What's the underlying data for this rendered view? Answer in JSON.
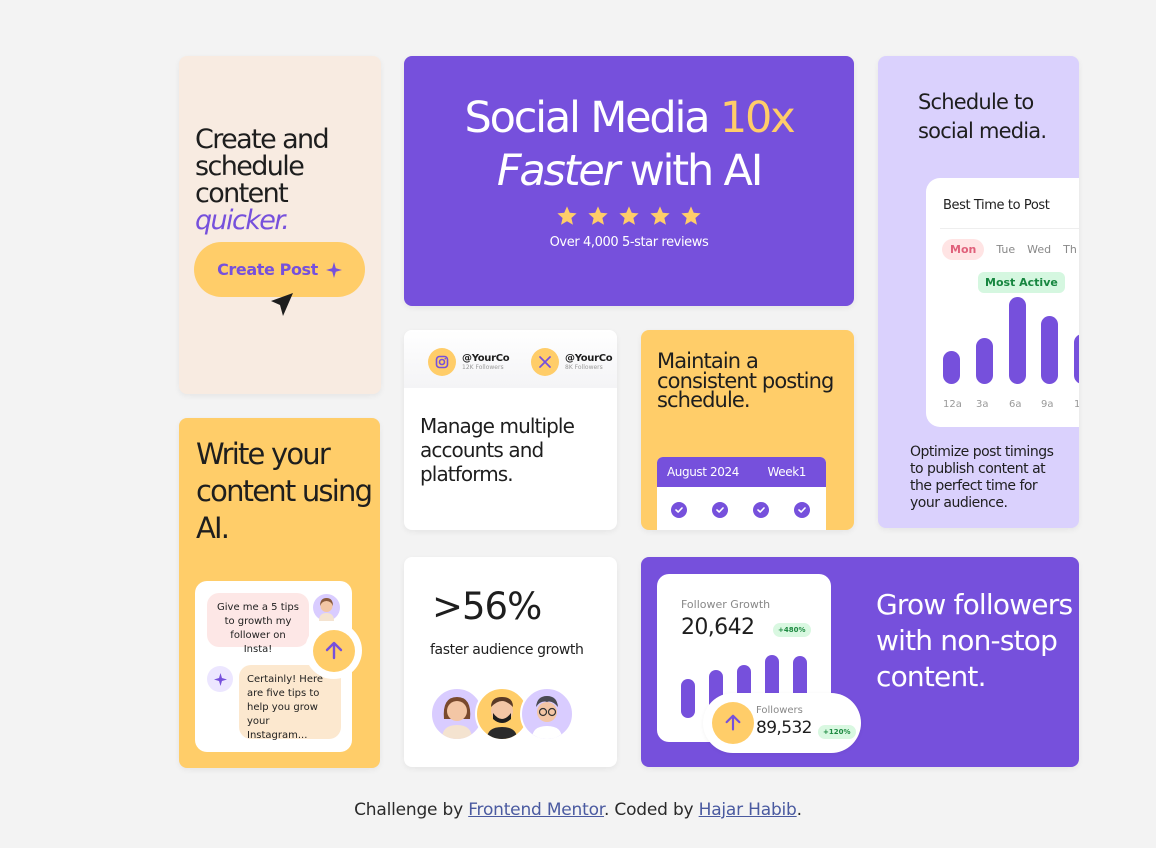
{
  "create": {
    "line1": "Create and",
    "line2": "schedule",
    "line3": "content",
    "accent": "quicker.",
    "button_label": "Create Post"
  },
  "hero": {
    "part1": "Social Media ",
    "accent": "10x",
    "italic": "Faster",
    "part2": " with AI",
    "rating": 5,
    "reviews": "Over 4,000 5-star reviews"
  },
  "schedule": {
    "title": "Schedule to social media.",
    "widget_title": "Best Time to Post",
    "days": [
      "Mon",
      "Tue",
      "Wed",
      "Th"
    ],
    "badge": "Most Active",
    "ticks": [
      "12a",
      "3a",
      "6a",
      "9a",
      "1"
    ],
    "bar_levels": [
      0.38,
      0.53,
      1.0,
      0.78,
      0.58
    ],
    "description": "Optimize post timings to publish content at the perfect time for your audience."
  },
  "write": {
    "title": "Write your content using AI.",
    "question": "Give me a 5 tips to growth my follower on Insta!",
    "answer": "Certainly! Here are five tips to help you grow your Instagram..."
  },
  "manage": {
    "accounts": [
      {
        "handle": "@YourCo",
        "followers": "12K Followers"
      },
      {
        "handle": "@YourCo",
        "followers": "8K Followers"
      }
    ],
    "title": "Manage multiple accounts and platforms."
  },
  "maintain": {
    "title": "Maintain a consistent posting schedule.",
    "month": "August 2024",
    "week": "Week1"
  },
  "stat": {
    "value": ">56%",
    "label": "faster audience growth"
  },
  "grow": {
    "chart_label": "Follower Growth",
    "chart_value": "20,642",
    "chart_badge": "+480%",
    "followers_label": "Followers",
    "followers_value": "89,532",
    "followers_badge": "+120%",
    "bar_levels": [
      0.55,
      0.68,
      0.75,
      0.9,
      0.88
    ],
    "title": "Grow followers with non-stop content."
  },
  "footer": {
    "prefix": "Challenge by ",
    "link1": "Frontend Mentor",
    "middle": ". Coded by ",
    "link2": "Hajar Habib",
    "suffix": "."
  },
  "colors": {
    "purple": "#7650dc",
    "yellow": "#ffcd69",
    "cream": "#f8ebe1",
    "lilac": "#dad1fd"
  }
}
